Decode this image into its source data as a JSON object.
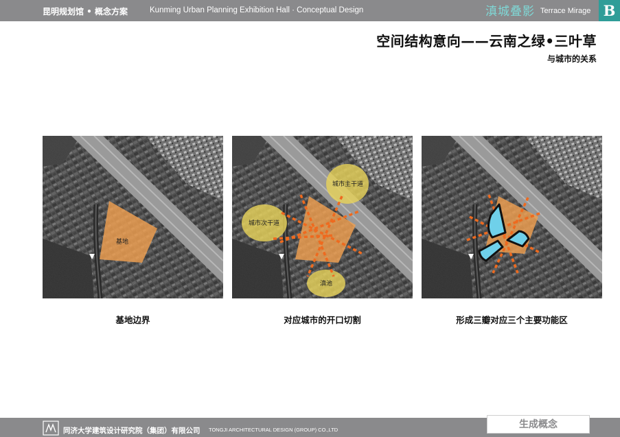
{
  "header": {
    "cn": "昆明规划馆 • 概念方案",
    "en": "Kunming Urban Planning Exhibition Hall · Conceptual Design",
    "brand_cn": "滇城叠影",
    "brand_en": "Terrace Mirage",
    "section_letter": "B"
  },
  "title": "空间结构意向——云南之绿•三叶草",
  "subtitle": "与城市的关系",
  "panels": [
    {
      "caption": "基地边界",
      "labels": {
        "site": "基地"
      }
    },
    {
      "caption": "对应城市的开口切割",
      "labels": {
        "main_road": "城市主干道",
        "secondary_road": "城市次干道",
        "lake": "滇池"
      }
    },
    {
      "caption": "形成三瓣对应三个主要功能区",
      "labels": {}
    }
  ],
  "colors": {
    "bar": "#8a8a8c",
    "accent": "#2f9d98",
    "site_fill": "#f0a050",
    "dash_orange": "#ee6a1f",
    "circle_yellow": "#e6d25a",
    "petal_cyan": "#6fd0ea"
  },
  "footer": {
    "company_cn": "同济大学建筑设计研究院（集团）有限公司",
    "company_en": "TONGJI ARCHITECTURAL DESIGN (GROUP) CO.,LTD",
    "section_label": "生成概念"
  }
}
